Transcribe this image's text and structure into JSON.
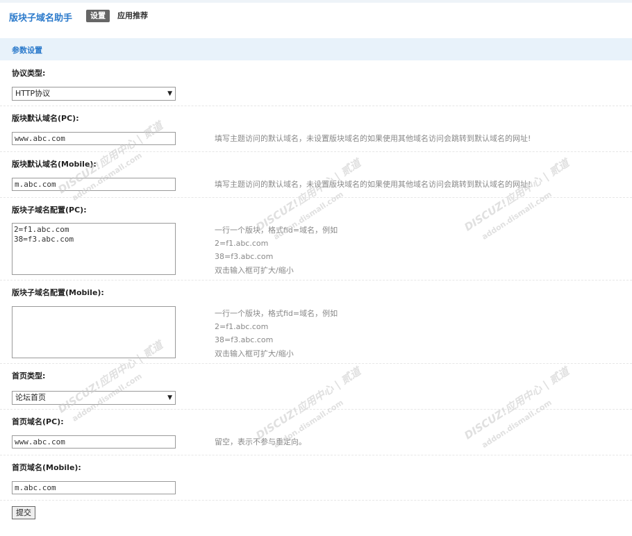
{
  "header": {
    "app_title": "版块子域名助手",
    "tabs": [
      {
        "label": "设置",
        "active": true
      },
      {
        "label": "应用推荐",
        "active": false
      }
    ]
  },
  "section": {
    "title": "参数设置"
  },
  "form": {
    "protocol": {
      "label": "协议类型:",
      "value": "HTTP协议"
    },
    "default_pc": {
      "label": "版块默认域名(PC):",
      "value": "www.abc.com",
      "hint": "填写主题访问的默认域名，未设置版块域名的如果使用其他域名访问会跳转到默认域名的网址!"
    },
    "default_mobile": {
      "label": "版块默认域名(Mobile):",
      "value": "m.abc.com",
      "hint": "填写主题访问的默认域名，未设置版块域名的如果使用其他域名访问会跳转到默认域名的网址!"
    },
    "sub_pc": {
      "label": "版块子域名配置(PC):",
      "lines": [
        "2=f1.abc.com",
        "38=f3.abc.com"
      ],
      "hints": [
        "一行一个版块，格式fid=域名，例如",
        "2=f1.abc.com",
        "38=f3.abc.com",
        "双击输入框可扩大/缩小"
      ]
    },
    "sub_mobile": {
      "label": "版块子域名配置(Mobile):",
      "lines": [],
      "hints": [
        "一行一个版块，格式fid=域名，例如",
        "2=f1.abc.com",
        "38=f3.abc.com",
        "双击输入框可扩大/缩小"
      ]
    },
    "home_type": {
      "label": "首页类型:",
      "value": "论坛首页"
    },
    "home_pc": {
      "label": "首页域名(PC):",
      "value": "www.abc.com",
      "hint": "留空，表示不参与重定向。"
    },
    "home_mobile": {
      "label": "首页域名(Mobile):",
      "value": "m.abc.com"
    },
    "submit_label": "提交"
  },
  "watermark": {
    "brand": "DISCUZ!应用中心 | 贰道",
    "domain": "addon.dismall.com"
  },
  "colors": {
    "accent": "#2b7acb",
    "section_bg": "#e8f2fa"
  },
  "icons": {
    "select_arrow": "triangle-down-icon"
  }
}
